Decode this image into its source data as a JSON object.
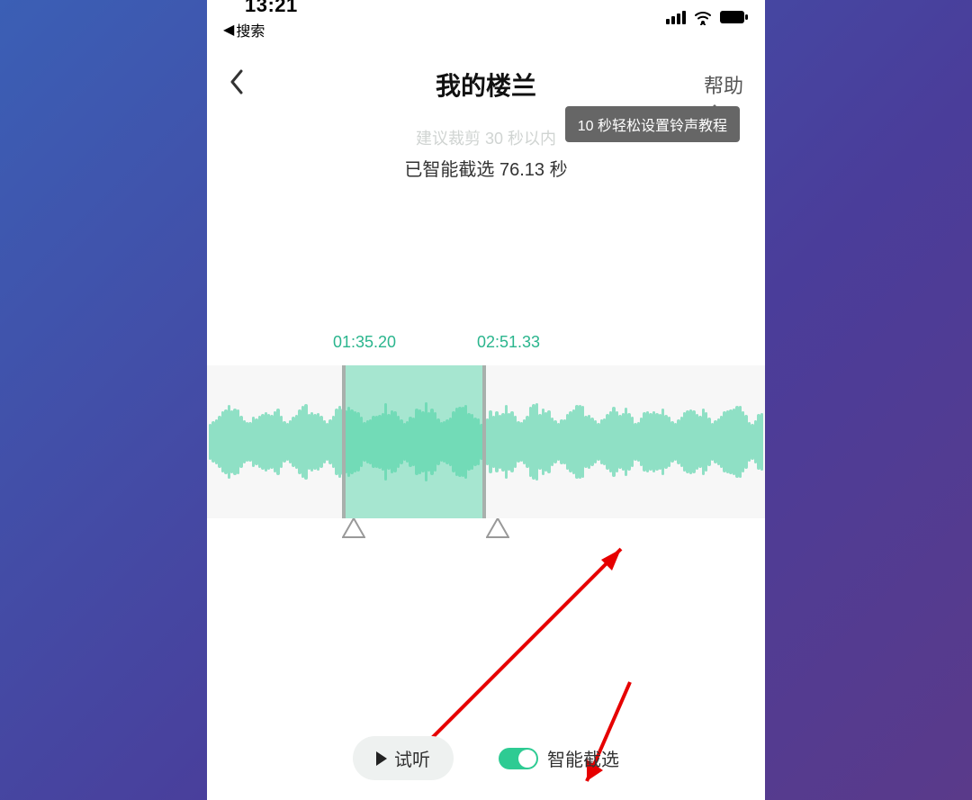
{
  "status": {
    "time": "13:21",
    "back_label": "搜索"
  },
  "nav": {
    "title": "我的楼兰",
    "help": "帮助"
  },
  "tooltip": {
    "text": "10 秒轻松设置铃声教程"
  },
  "hints": {
    "suggest": "建议裁剪 30 秒以内",
    "picked": "已智能截选 76.13 秒"
  },
  "timeline": {
    "start": "01:35.20",
    "end": "02:51.33"
  },
  "controls": {
    "preview": "试听",
    "smart_cut": "智能截选"
  },
  "colors": {
    "accent": "#2ecb93"
  }
}
